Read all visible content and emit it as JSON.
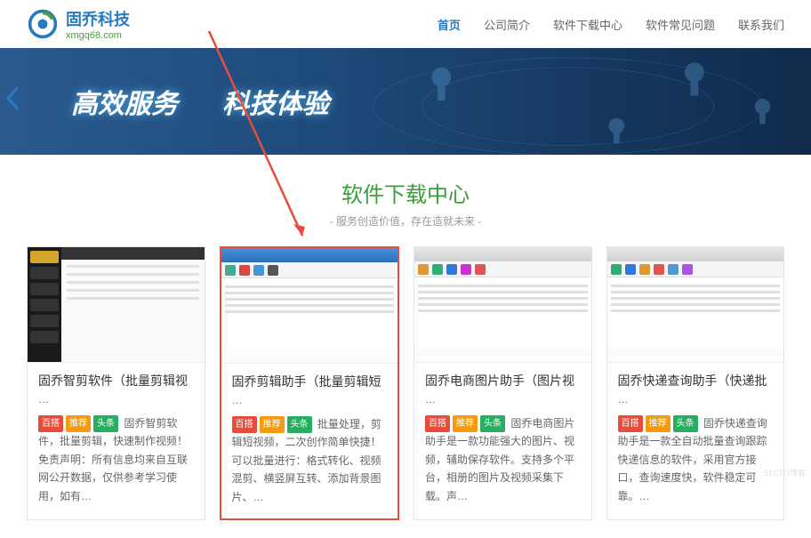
{
  "header": {
    "brand": "固乔科技",
    "domain": "xmgq68.com",
    "nav": [
      "首页",
      "公司简介",
      "软件下载中心",
      "软件常见问题",
      "联系我们"
    ],
    "active_index": 0
  },
  "hero": {
    "text1": "高效服务",
    "text2": "科技体验"
  },
  "section": {
    "title": "软件下载中心",
    "subtitle": "- 服务创造价值，存在造就未来 -"
  },
  "tags": {
    "red": "百搭",
    "orange": "推荐",
    "green": "头条"
  },
  "cards": [
    {
      "title": "固乔智剪软件（批量剪辑视",
      "desc": "固乔智剪软件，批量剪辑，快速制作视频！免责声明：所有信息均来自互联网公开数据，仅供参考学习使用，如有…"
    },
    {
      "title": "固乔剪辑助手（批量剪辑短",
      "desc": "批量处理，剪辑短视频，二次创作简单快捷！可以批量进行：格式转化、视频混剪、横竖屏互转、添加背景图片、…"
    },
    {
      "title": "固乔电商图片助手（图片视",
      "desc": "固乔电商图片助手是一款功能强大的图片、视频，辅助保存软件。支持多个平台，相册的图片及视频采集下载。声…"
    },
    {
      "title": "固乔快递查询助手（快递批",
      "desc": "固乔快递查询助手是一款全自动批量查询跟踪快递信息的软件，采用官方接口，查询速度快，软件稳定可靠。…"
    }
  ],
  "watermark": "51CTO博客"
}
